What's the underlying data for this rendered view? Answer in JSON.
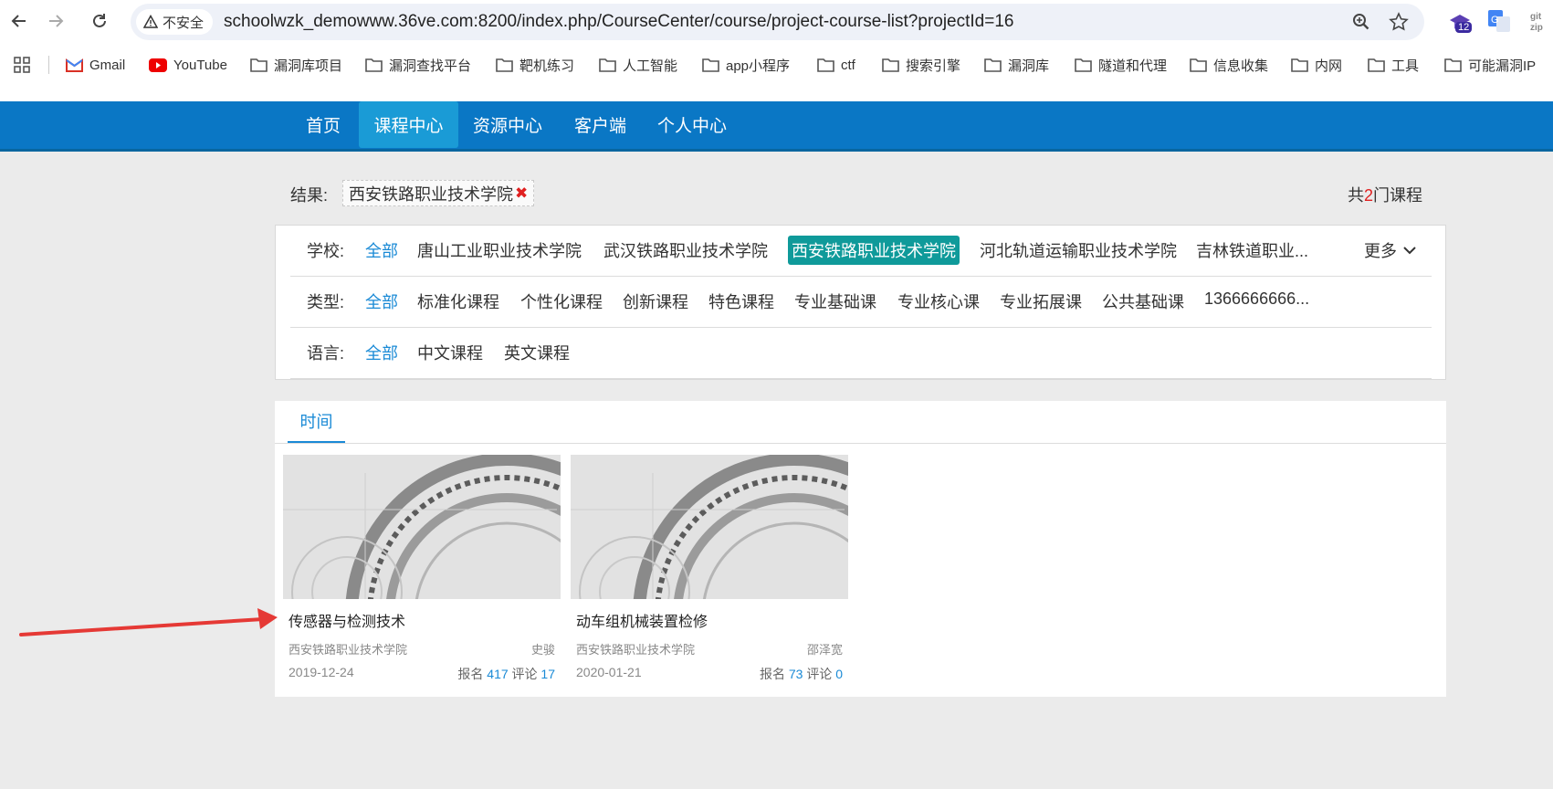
{
  "browser": {
    "insecure_label": "不安全",
    "url": "schoolwzk_demowww.36ve.com:8200/index.php/CourseCenter/course/project-course-list?projectId=16",
    "ext_badge": "12",
    "bookmarks": [
      "Gmail",
      "YouTube",
      "漏洞库项目",
      "漏洞查找平台",
      "靶机练习",
      "人工智能",
      "app小程序",
      "ctf",
      "搜索引擎",
      "漏洞库",
      "隧道和代理",
      "信息收集",
      "内网",
      "工具",
      "可能漏洞IP"
    ]
  },
  "nav": {
    "items": [
      "首页",
      "课程中心",
      "资源中心",
      "客户端",
      "个人中心"
    ],
    "active": "课程中心"
  },
  "results": {
    "label": "结果:",
    "tag": "西安铁路职业技术学院",
    "tag_close": "✖",
    "count_prefix": "共",
    "count": "2",
    "count_suffix": "门课程"
  },
  "filters": {
    "school": {
      "label": "学校:",
      "all": "全部",
      "options": [
        "唐山工业职业技术学院",
        "武汉铁路职业技术学院",
        "西安铁路职业技术学院",
        "河北轨道运输职业技术学院",
        "吉林铁道职业..."
      ],
      "selected": "西安铁路职业技术学院",
      "more": "更多"
    },
    "type": {
      "label": "类型:",
      "all": "全部",
      "options": [
        "标准化课程",
        "个性化课程",
        "创新课程",
        "特色课程",
        "专业基础课",
        "专业核心课",
        "专业拓展课",
        "公共基础课",
        "1366666666..."
      ]
    },
    "language": {
      "label": "语言:",
      "all": "全部",
      "options": [
        "中文课程",
        "英文课程"
      ]
    }
  },
  "sort_tab": "时间",
  "courses": [
    {
      "title": "传感器与检测技术",
      "school": "西安铁路职业技术学院",
      "teacher": "史骏",
      "date": "2019-12-24",
      "enroll_label": "报名",
      "enroll": "417",
      "comment_label": "评论",
      "comments": "17"
    },
    {
      "title": "动车组机械装置检修",
      "school": "西安铁路职业技术学院",
      "teacher": "邵泽宽",
      "date": "2020-01-21",
      "enroll_label": "报名",
      "enroll": "73",
      "comment_label": "评论",
      "comments": "0"
    }
  ],
  "colors": {
    "nav_bg": "#0a77c5",
    "nav_active": "#1a9bd6",
    "link_blue": "#1a8ad6",
    "selected_teal": "#0f9a9a",
    "count_red": "#e02020",
    "annotation_arrow": "#e53935"
  }
}
